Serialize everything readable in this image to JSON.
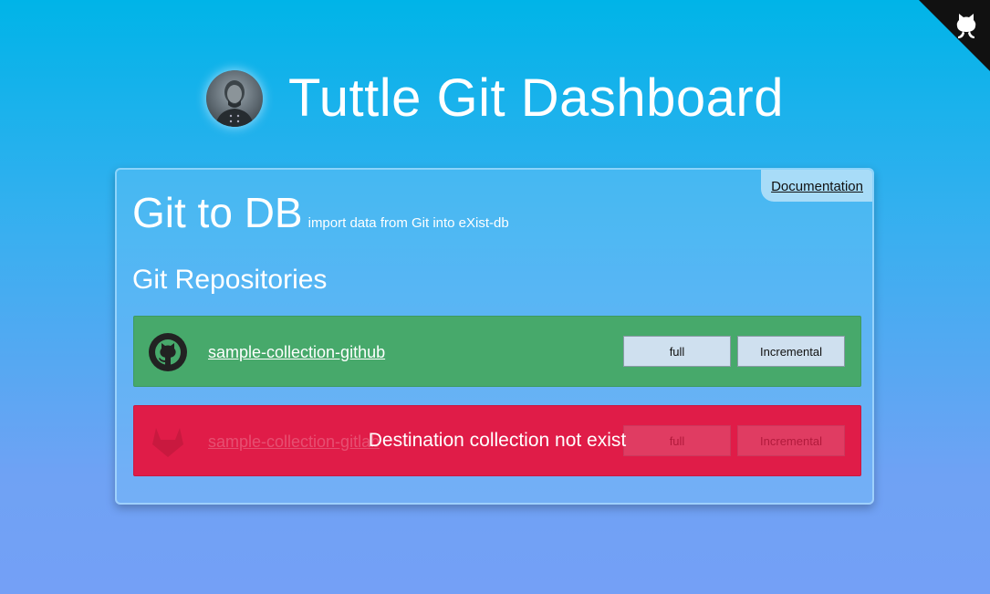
{
  "header": {
    "title": "Tuttle Git Dashboard"
  },
  "corner": {
    "icon": "github-octocat-icon"
  },
  "card": {
    "doc_link": "Documentation",
    "title": "Git to DB",
    "subtitle": "import data from Git into eXist-db",
    "section_title": "Git Repositories"
  },
  "repos": [
    {
      "name": "sample-collection-github",
      "icon": "github-icon",
      "status": "ok",
      "full_label": "full",
      "incremental_label": "Incremental",
      "color": "#47a96b"
    },
    {
      "name": "sample-collection-gitlab",
      "icon": "gitlab-icon",
      "status": "error",
      "error_message": "Destination collection not exist",
      "full_label": "full",
      "incremental_label": "Incremental",
      "color": "#e01c48"
    }
  ]
}
